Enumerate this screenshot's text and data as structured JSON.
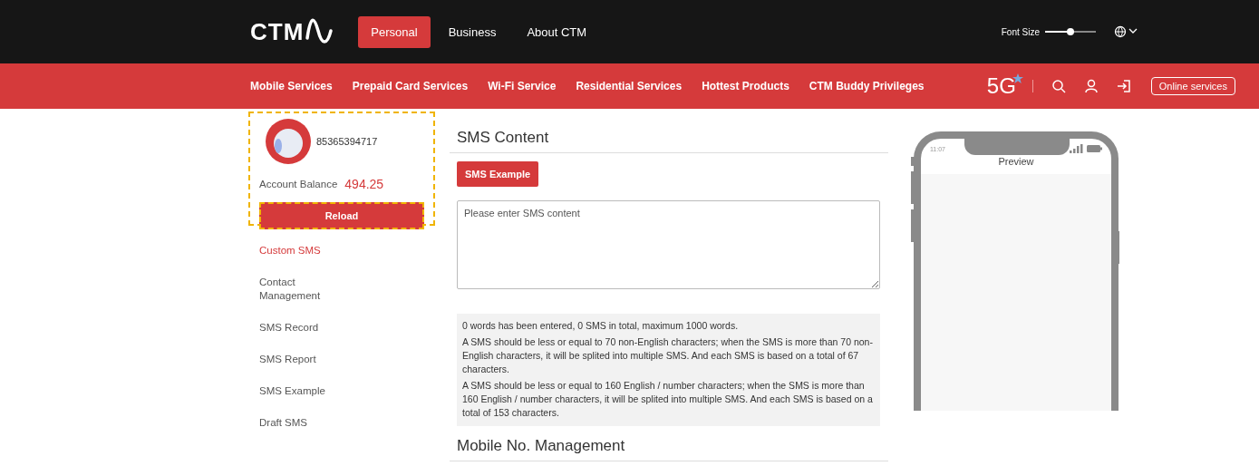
{
  "header": {
    "logo": "CTM",
    "tabs": [
      {
        "label": "Personal",
        "selected": true
      },
      {
        "label": "Business",
        "selected": false
      },
      {
        "label": "About CTM",
        "selected": false
      }
    ],
    "font_size": {
      "label": "Font Size",
      "level": 0.5
    }
  },
  "nav": {
    "items": [
      "Mobile Services",
      "Prepaid Card Services",
      "Wi-Fi Service",
      "Residential Services",
      "Hottest Products",
      "CTM Buddy Privileges"
    ],
    "badge": "5G",
    "online_button": "Online services"
  },
  "account": {
    "number": "85365394717",
    "balance_label": "Account Balance",
    "balance": "494.25",
    "reload_button": "Reload"
  },
  "sidebar": {
    "items": [
      {
        "label": "Custom SMS",
        "selected": true
      },
      {
        "label": "Contact Management",
        "selected": false
      },
      {
        "label": "SMS Record",
        "selected": false
      },
      {
        "label": "SMS Report",
        "selected": false
      },
      {
        "label": "SMS Example",
        "selected": false
      },
      {
        "label": "Draft SMS",
        "selected": false
      }
    ]
  },
  "sms_content": {
    "title": "SMS Content",
    "example_button": "SMS Example",
    "placeholder": "Please enter SMS content",
    "notes": [
      "0 words has been entered, 0 SMS in total, maximum 1000 words.",
      "A SMS should be less or equal to 70 non-English characters; when the SMS is more than 70 non-English characters, it will be splited into multiple SMS. And each SMS is based on a total of 67 characters.",
      "A SMS should be less or equal to 160 English / number characters; when the SMS is more than 160 English / number characters, it will be splited into multiple SMS. And each SMS is based on a total of 153 characters."
    ]
  },
  "preview": {
    "time": "11:07",
    "title": "Preview"
  },
  "mobile_management": {
    "title": "Mobile No. Management"
  }
}
